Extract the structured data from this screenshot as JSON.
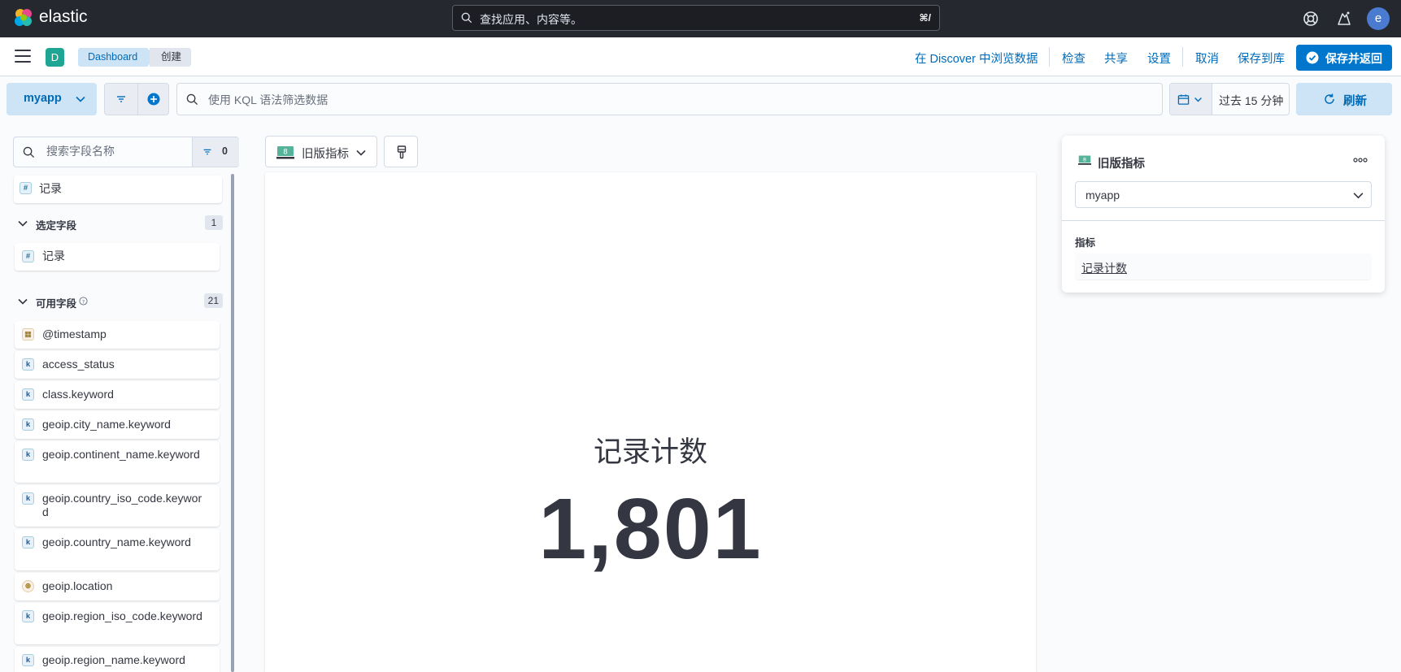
{
  "header": {
    "brand": "elastic",
    "search_placeholder": "查找应用、内容等。",
    "search_shortcut": "⌘/",
    "avatar_initial": "e"
  },
  "nav": {
    "space_initial": "D",
    "breadcrumbs": [
      "Dashboard",
      "创建"
    ],
    "links": {
      "discover": "在 Discover 中浏览数据",
      "inspect": "检查",
      "share": "共享",
      "settings": "设置",
      "cancel": "取消",
      "save_to_library": "保存到库"
    },
    "save_and_return": "保存并返回"
  },
  "query_bar": {
    "data_view": "myapp",
    "kql_placeholder": "使用 KQL 语法筛选数据",
    "time_range": "过去 15 分钟",
    "refresh": "刷新"
  },
  "fields_panel": {
    "search_placeholder": "搜索字段名称",
    "filter_count": "0",
    "records_item": "记录",
    "selected_section": {
      "label": "选定字段",
      "count": "1",
      "items": [
        {
          "name": "记录",
          "type": "#"
        }
      ]
    },
    "available_section": {
      "label": "可用字段",
      "count": "21",
      "items": [
        {
          "name": "@timestamp",
          "type": "date"
        },
        {
          "name": "access_status",
          "type": "k"
        },
        {
          "name": "class.keyword",
          "type": "k"
        },
        {
          "name": "geoip.city_name.keyword",
          "type": "k"
        },
        {
          "name": "geoip.continent_name.keyword",
          "type": "k"
        },
        {
          "name": "geoip.country_iso_code.keyword",
          "type": "k"
        },
        {
          "name": "geoip.country_name.keyword",
          "type": "k"
        },
        {
          "name": "geoip.location",
          "type": "geo"
        },
        {
          "name": "geoip.region_iso_code.keyword",
          "type": "k"
        },
        {
          "name": "geoip.region_name.keyword",
          "type": "k"
        }
      ]
    }
  },
  "workspace": {
    "vis_type": "旧版指标",
    "metric_label": "记录计数",
    "metric_value": "1,801"
  },
  "config_panel": {
    "title": "旧版指标",
    "layer_data_view": "myapp",
    "group_label": "指标",
    "dimension": "记录计数"
  },
  "colors": {
    "accent": "#0077cc",
    "header_bg": "#25282f",
    "space_badge": "#1ea593",
    "avatar": "#4a7bd0"
  }
}
